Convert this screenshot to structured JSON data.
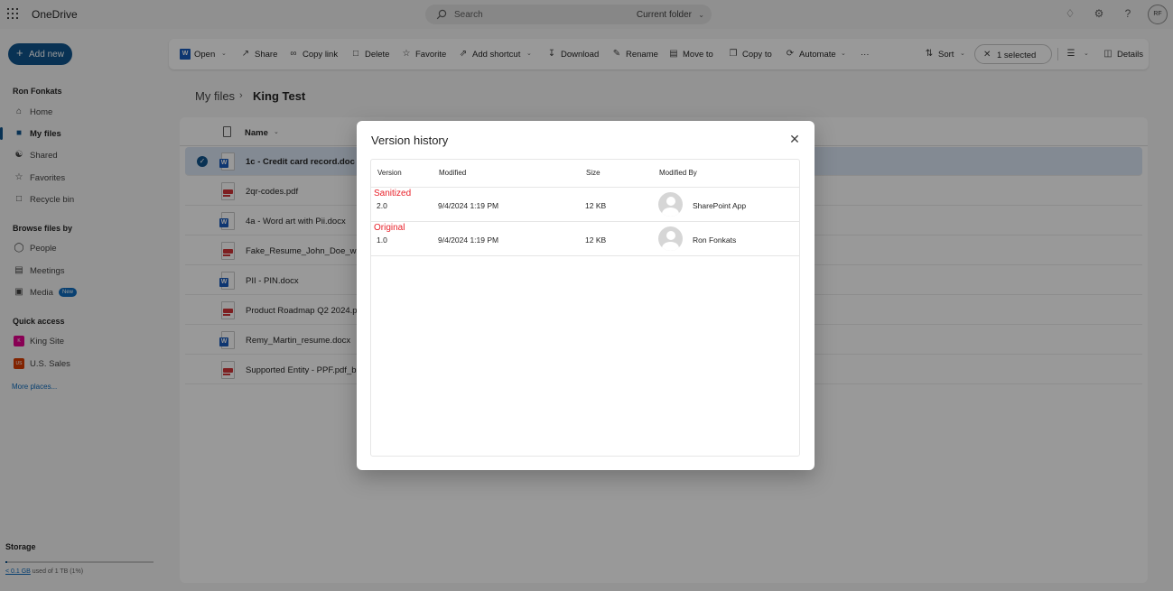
{
  "app": {
    "title": "OneDrive"
  },
  "search": {
    "placeholder": "Search",
    "scope": "Current folder"
  },
  "user": {
    "initials": "RF",
    "name": "Ron Fonkats"
  },
  "nav": {
    "add_new": "Add new",
    "items": [
      {
        "label": "Home",
        "icon": "home-icon"
      },
      {
        "label": "My files",
        "icon": "folder-icon",
        "active": true
      },
      {
        "label": "Shared",
        "icon": "people-icon"
      },
      {
        "label": "Favorites",
        "icon": "star-icon"
      },
      {
        "label": "Recycle bin",
        "icon": "trash-icon"
      }
    ],
    "browse_title": "Browse files by",
    "browse": [
      {
        "label": "People",
        "icon": "person-icon"
      },
      {
        "label": "Meetings",
        "icon": "calendar-icon"
      },
      {
        "label": "Media",
        "icon": "image-icon",
        "badge": "New"
      }
    ],
    "quick_title": "Quick access",
    "quick": [
      {
        "label": "King Site",
        "initials": "K",
        "color": "#e3008c"
      },
      {
        "label": "U.S. Sales",
        "initials": "US",
        "color": "#d83b01"
      }
    ],
    "more_places": "More places..."
  },
  "storage": {
    "title": "Storage",
    "used": "< 0.1 GB",
    "suffix": "used of 1 TB (1%)",
    "percent": 1
  },
  "commands": {
    "open": "Open",
    "share": "Share",
    "copy_link": "Copy link",
    "delete": "Delete",
    "favorite": "Favorite",
    "add_shortcut": "Add shortcut",
    "download": "Download",
    "rename": "Rename",
    "move_to": "Move to",
    "copy_to": "Copy to",
    "automate": "Automate",
    "more": "···",
    "sort": "Sort",
    "selected": "1 selected",
    "details": "Details"
  },
  "breadcrumb": {
    "root": "My files",
    "current": "King Test"
  },
  "list": {
    "column_name": "Name",
    "files": [
      {
        "name": "1c - Credit card record.doc",
        "type": "word",
        "selected": true
      },
      {
        "name": "2qr-codes.pdf",
        "type": "pdf"
      },
      {
        "name": "4a - Word art with Pii.docx",
        "type": "word"
      },
      {
        "name": "Fake_Resume_John_Doe_with",
        "type": "pdf"
      },
      {
        "name": "PII - PIN.docx",
        "type": "word"
      },
      {
        "name": "Product Roadmap Q2 2024.p",
        "type": "pdf"
      },
      {
        "name": "Remy_Martin_resume.docx",
        "type": "word"
      },
      {
        "name": "Supported Entity - PPF.pdf_bl",
        "type": "pdf"
      }
    ]
  },
  "dialog": {
    "title": "Version history",
    "columns": {
      "version": "Version",
      "modified": "Modified",
      "size": "Size",
      "modified_by": "Modified By"
    },
    "rows": [
      {
        "tag": "Sanitized",
        "version": "2.0",
        "modified": "9/4/2024 1:19 PM",
        "size": "12 KB",
        "modified_by": "SharePoint App"
      },
      {
        "tag": "Original",
        "version": "1.0",
        "modified": "9/4/2024 1:19 PM",
        "size": "12 KB",
        "modified_by": "Ron Fonkats"
      }
    ]
  },
  "colors": {
    "brand": "#0f548c",
    "annotation": "#e8212a",
    "word": "#185abd",
    "pdf": "#d13438"
  }
}
